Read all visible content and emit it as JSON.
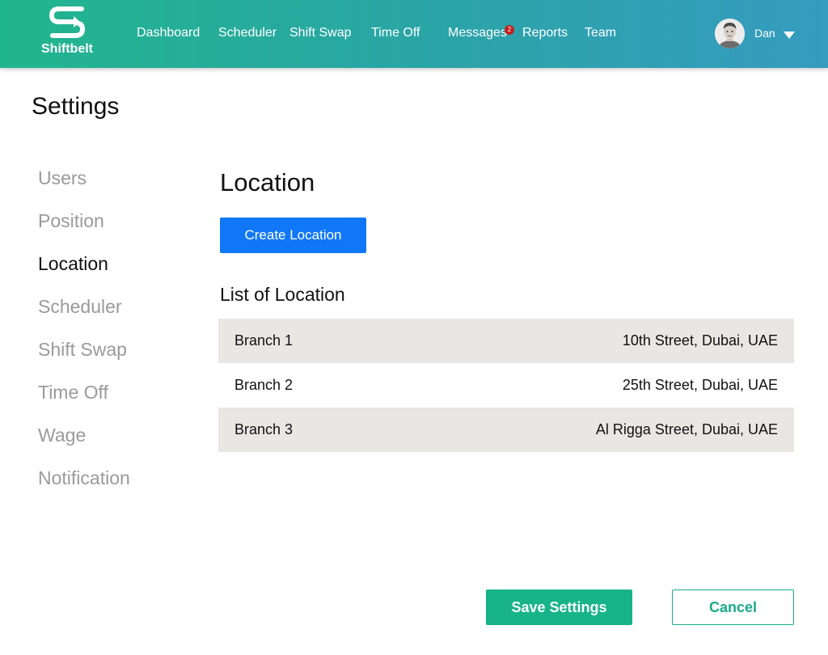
{
  "app": {
    "name": "Shiftbelt",
    "logo_icon": "shiftbelt-s-arrows-icon",
    "brand_gradient": [
      "#21b58d",
      "#359bbf"
    ]
  },
  "nav": {
    "items": [
      {
        "label": "Dashboard"
      },
      {
        "label": "Scheduler"
      },
      {
        "label": "Shift Swap"
      },
      {
        "label": "Time Off"
      },
      {
        "label": "Messages",
        "badge": "2"
      },
      {
        "label": "Reports"
      },
      {
        "label": "Team"
      }
    ]
  },
  "user": {
    "name": "Dan",
    "avatar_icon": "user-avatar-photo",
    "menu_icon": "caret-down-icon"
  },
  "page": {
    "title": "Settings"
  },
  "sidebar": {
    "items": [
      {
        "label": "Users"
      },
      {
        "label": "Position"
      },
      {
        "label": "Location",
        "active": true
      },
      {
        "label": "Scheduler"
      },
      {
        "label": "Shift Swap"
      },
      {
        "label": "Time Off"
      },
      {
        "label": "Wage"
      },
      {
        "label": "Notification"
      }
    ]
  },
  "location": {
    "title": "Location",
    "create_button": "Create Location",
    "list_title": "List of Location",
    "rows": [
      {
        "name": "Branch 1",
        "address": "10th Street, Dubai, UAE"
      },
      {
        "name": "Branch 2",
        "address": "25th Street, Dubai, UAE"
      },
      {
        "name": "Branch 3",
        "address": "Al Rigga Street, Dubai, UAE"
      }
    ]
  },
  "footer": {
    "save_label": "Save Settings",
    "cancel_label": "Cancel"
  },
  "colors": {
    "primary_blue": "#1077f8",
    "save_green": "#16b488",
    "cancel_teal": "#1aaa8b",
    "row_stripe": "#e9e7e3",
    "badge_red": "#c51f1f"
  }
}
